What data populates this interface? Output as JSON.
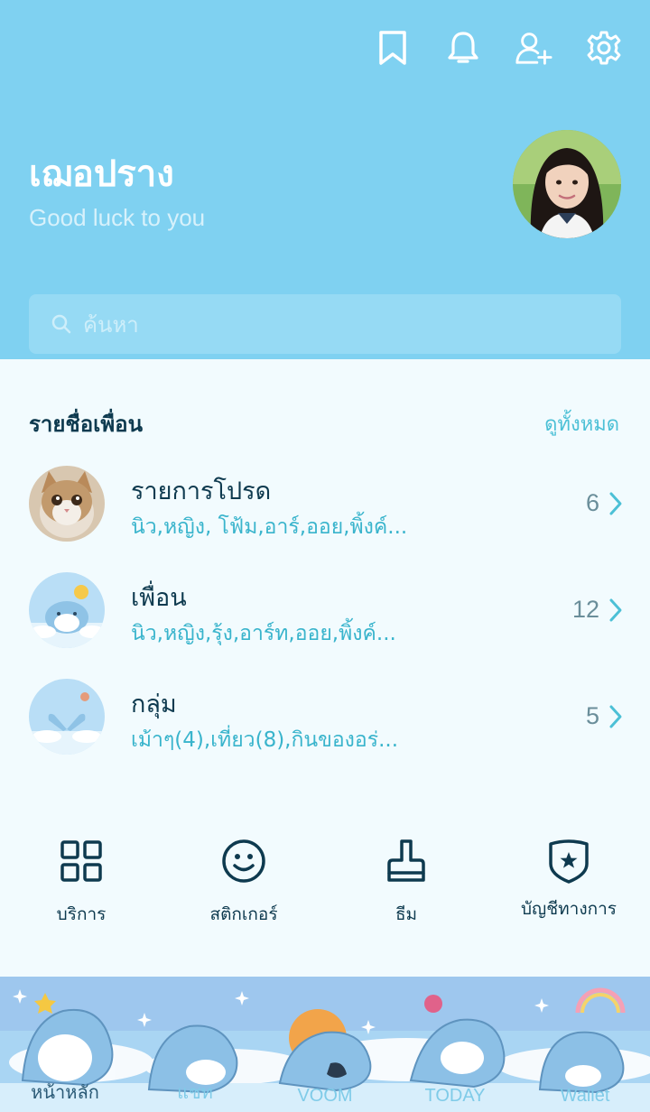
{
  "profile": {
    "name": "เฌอปราง",
    "status": "Good luck to you"
  },
  "search": {
    "placeholder": "ค้นหา"
  },
  "friends_section": {
    "title": "รายชื่อเพื่อน",
    "see_all": "ดูทั้งหมด",
    "rows": [
      {
        "title": "รายการโปรด",
        "subtitle": "นิว,หญิง, โฟ้ม,อาร์,ออย,พิ้งค์...",
        "count": "6"
      },
      {
        "title": "เพื่อน",
        "subtitle": "นิว,หญิง,รุ้ง,อาร์ท,ออย,พิ้งค์...",
        "count": "12"
      },
      {
        "title": "กลุ่ม",
        "subtitle": "เม้าๆ(4),เที่ยว(8),กินของอร่...",
        "count": "5"
      }
    ]
  },
  "actions": [
    {
      "label": "บริการ",
      "icon": "grid-icon"
    },
    {
      "label": "สติกเกอร์",
      "icon": "smiley-icon"
    },
    {
      "label": "ธีม",
      "icon": "brush-icon"
    },
    {
      "label": "บัญชีทางการ",
      "icon": "shield-star-icon"
    }
  ],
  "bottom_nav": [
    {
      "label": "หน้าหลัก",
      "active": true
    },
    {
      "label": "แชท",
      "active": false
    },
    {
      "label": "VOOM",
      "active": false
    },
    {
      "label": "TODAY",
      "active": false
    },
    {
      "label": "Wallet",
      "active": false
    }
  ],
  "colors": {
    "header": "#7fd1f1",
    "accent": "#39b4cc",
    "text_dark": "#0e3a4f",
    "background": "#f2fbfe"
  }
}
